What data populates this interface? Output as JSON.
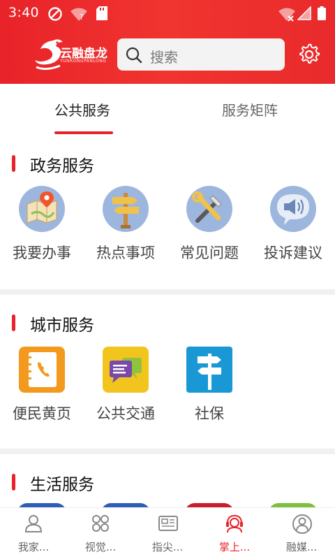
{
  "status_bar": {
    "time": "3:40"
  },
  "header": {
    "logo_text": "云融盘龙",
    "logo_subtext": "YUNRONGPANLONG",
    "search_placeholder": "搜索"
  },
  "tabs": [
    {
      "label": "公共服务",
      "active": true
    },
    {
      "label": "服务矩阵",
      "active": false
    }
  ],
  "sections": [
    {
      "title": "政务服务",
      "items": [
        {
          "label": "我要办事",
          "icon": "map-pin-icon"
        },
        {
          "label": "热点事项",
          "icon": "signpost-icon"
        },
        {
          "label": "常见问题",
          "icon": "tools-icon"
        },
        {
          "label": "投诉建议",
          "icon": "speaker-icon"
        }
      ]
    },
    {
      "title": "城市服务",
      "items": [
        {
          "label": "便民黄页",
          "icon": "phonebook-icon"
        },
        {
          "label": "公共交通",
          "icon": "chat-bubbles-icon"
        },
        {
          "label": "社保",
          "icon": "direction-sign-icon"
        }
      ]
    },
    {
      "title": "生活服务",
      "items": []
    }
  ],
  "bottom_nav": [
    {
      "label": "我家...",
      "icon": "person-icon",
      "active": false
    },
    {
      "label": "视觉...",
      "icon": "grid-flower-icon",
      "active": false
    },
    {
      "label": "指尖...",
      "icon": "newspaper-icon",
      "active": false
    },
    {
      "label": "掌上...",
      "icon": "headset-person-icon",
      "active": true
    },
    {
      "label": "融媒...",
      "icon": "user-circle-icon",
      "active": false
    }
  ],
  "colors": {
    "brand_red": "#e8232a",
    "tab_indicator": "#e8232a",
    "active_nav": "#e8232a"
  }
}
